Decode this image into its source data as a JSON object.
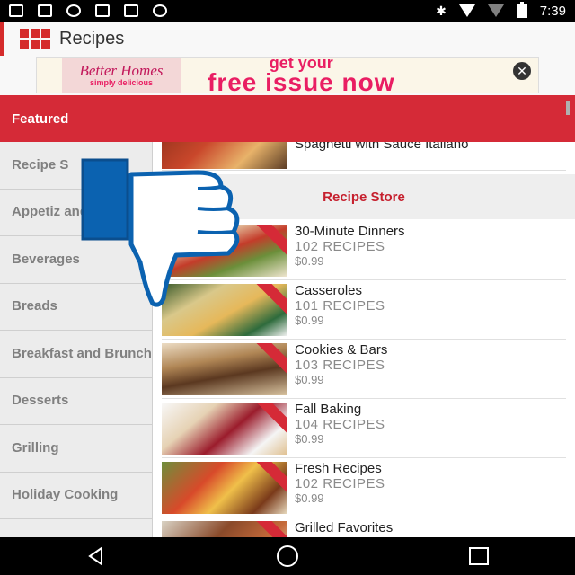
{
  "status_bar": {
    "time": "7:39",
    "icons": [
      "facebook-icon",
      "image-icon",
      "info-icon",
      "lock-icon",
      "tools-icon",
      "android-icon",
      "bluetooth-icon",
      "wifi-icon",
      "signal-icon",
      "battery-icon"
    ]
  },
  "app_bar": {
    "title": "Recipes",
    "accent_color": "#d52b2b"
  },
  "ad": {
    "magazine_brand": "Better Homes",
    "magazine_subtitle": "simply delicious",
    "headline_top": "get your",
    "headline_main": "free issue now",
    "close_symbol": "✕"
  },
  "featured": {
    "label": "Featured",
    "color": "#d52a37"
  },
  "sidebar": {
    "items": [
      {
        "label": "Recipe S"
      },
      {
        "label": "Appetiz and Sna"
      },
      {
        "label": "Beverages"
      },
      {
        "label": "Breads"
      },
      {
        "label": "Breakfast and Brunch"
      },
      {
        "label": "Desserts"
      },
      {
        "label": "Grilling"
      },
      {
        "label": "Holiday Cooking"
      }
    ]
  },
  "content": {
    "partial_title": "Spaghetti with Sauce Italiano",
    "store_label": "Recipe Store",
    "recipes": [
      {
        "title": "30-Minute Dinners",
        "count": "102 RECIPES",
        "price": "$0.99"
      },
      {
        "title": "Casseroles",
        "count": "101 RECIPES",
        "price": "$0.99"
      },
      {
        "title": "Cookies & Bars",
        "count": "103 RECIPES",
        "price": "$0.99"
      },
      {
        "title": "Fall Baking",
        "count": "104 RECIPES",
        "price": "$0.99"
      },
      {
        "title": "Fresh Recipes",
        "count": "102 RECIPES",
        "price": "$0.99"
      },
      {
        "title": "Grilled Favorites",
        "count": "",
        "price": ""
      }
    ]
  },
  "overlay": {
    "icon": "thumbs-down-icon",
    "color": "#0b62b0"
  }
}
